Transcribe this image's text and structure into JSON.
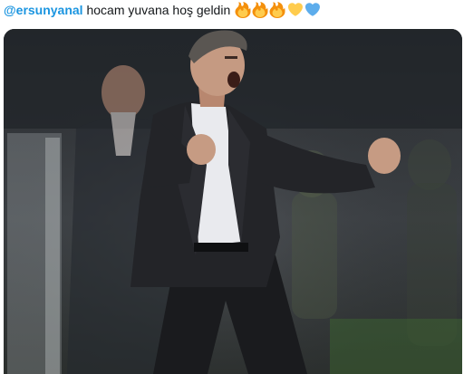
{
  "tweet": {
    "mention": "@ersunyanal",
    "text": " hocam yuvana hoş geldin ",
    "emojis": [
      "fire-icon",
      "fire-icon",
      "fire-icon",
      "yellow-heart-icon",
      "blue-heart-icon"
    ]
  },
  "media": {
    "type": "photo"
  },
  "colors": {
    "mention": "#1b95e0",
    "text": "#14171a",
    "fire_outer": "#f4900c",
    "fire_inner": "#ffcc4d",
    "yellow_heart": "#ffcc4d",
    "blue_heart": "#5dadec"
  }
}
